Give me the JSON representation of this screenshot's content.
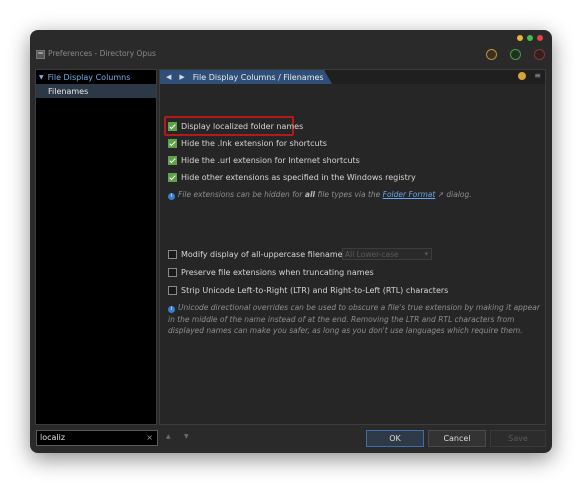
{
  "window": {
    "title": "Preferences - Directory Opus"
  },
  "tree": {
    "root_label": "File Display Columns",
    "selected_item": "Filenames"
  },
  "header": {
    "breadcrumb": "File Display Columns / Filenames",
    "back_icon": "arrow-left-icon",
    "forward_icon": "arrow-right-icon"
  },
  "options": [
    {
      "label": "Display localized folder names",
      "checked": true
    },
    {
      "label": "Hide the .lnk extension for shortcuts",
      "checked": true
    },
    {
      "label": "Hide the .url extension for Internet shortcuts",
      "checked": true
    },
    {
      "label": "Hide other extensions as specified in the Windows registry",
      "checked": true
    },
    {
      "label": "Modify display of all-uppercase filenames:",
      "checked": false
    },
    {
      "label": "Preserve file extensions when truncating names",
      "checked": false
    },
    {
      "label": "Strip Unicode Left-to-Right (LTR) and Right-to-Left (RTL) characters",
      "checked": false
    }
  ],
  "info1": {
    "pre": "File extensions can be hidden for ",
    "bold": "all",
    "mid": " file types via the ",
    "link": "Folder Format",
    "post": " dialog."
  },
  "uppercase_select": "All Lower-case",
  "info2": {
    "line1": "Unicode directional overrides can be used to obscure a file's true extension by making it appear",
    "line2": "in the middle of the name instead of at the end. Removing the LTR and RTL characters from",
    "line3": "displayed names can make you safer, as long as you don't use languages which require them."
  },
  "search": {
    "value": "localiz",
    "clear": "×"
  },
  "buttons": {
    "ok": "OK",
    "cancel": "Cancel",
    "save": "Save"
  }
}
